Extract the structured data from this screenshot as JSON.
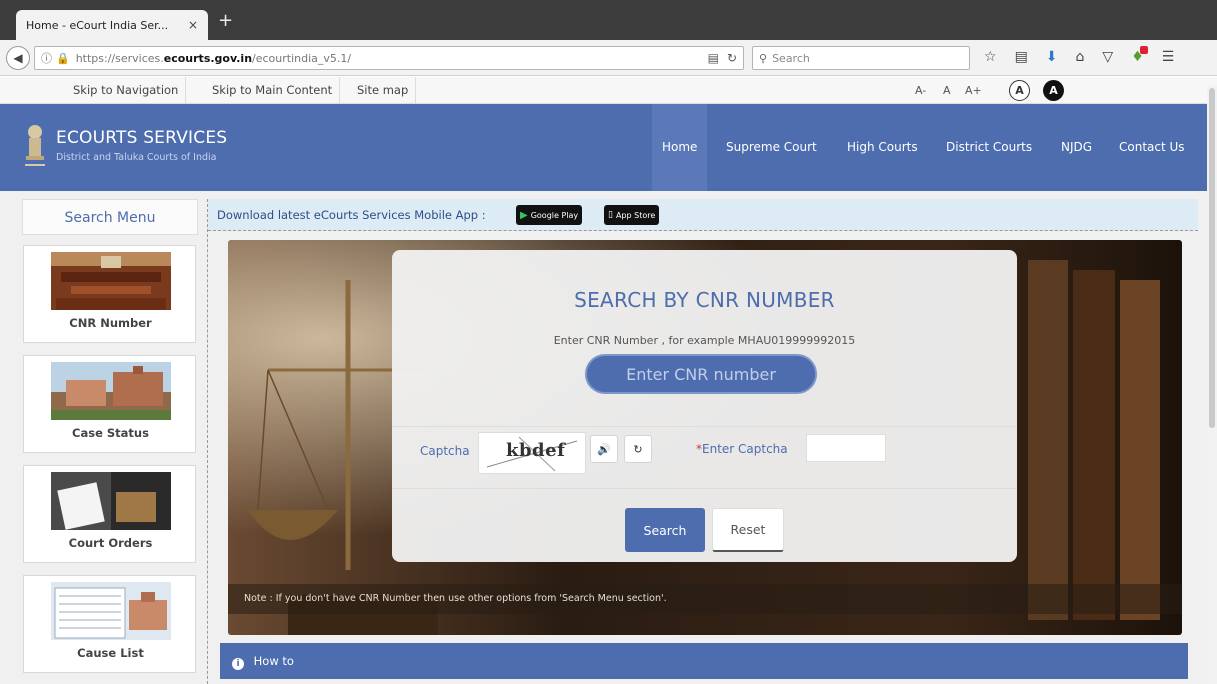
{
  "browser": {
    "tab_title": "Home - eCourt India Ser...",
    "tab_close": "×",
    "new_tab": "+",
    "url_pre": "https://services.",
    "url_domain": "ecourts.gov.in",
    "url_post": "/ecourtindia_v5.1/",
    "search_placeholder": "Search"
  },
  "topstrip": {
    "skip_navigation": "Skip to Navigation",
    "skip_main": "Skip to Main Content",
    "site_map": "Site map",
    "font_small": "A-",
    "font_normal": "A",
    "font_large": "A+",
    "contrast_light": "A",
    "contrast_dark": "A"
  },
  "header": {
    "title": "ECOURTS SERVICES",
    "subtitle": "District and Taluka Courts of India",
    "menu": [
      "Home",
      "Supreme Court",
      "High Courts",
      "District Courts",
      "NJDG",
      "Contact Us"
    ]
  },
  "sidebar": {
    "title": "Search Menu",
    "items": [
      {
        "label": "CNR Number"
      },
      {
        "label": "Case Status"
      },
      {
        "label": "Court Orders"
      },
      {
        "label": "Cause List"
      }
    ]
  },
  "appbar": {
    "text": "Download latest eCourts Services Mobile App :",
    "google_play": "Google Play",
    "app_store": "App Store"
  },
  "search": {
    "title": "SEARCH BY CNR NUMBER",
    "hint": "Enter CNR Number , for example MHAU019999992015",
    "cnr_placeholder": "Enter CNR number",
    "captcha_label": "Captcha",
    "captcha_text": "kbdef",
    "enter_captcha_required": "*",
    "enter_captcha": "Enter Captcha",
    "search_button": "Search",
    "reset_button": "Reset",
    "note": "Note : If you don't have CNR Number then use other options from 'Search Menu section'."
  },
  "howto": {
    "label": "How to"
  },
  "colors": {
    "brand_blue": "#4d6dae",
    "appbar_bg": "#dcebf4"
  }
}
